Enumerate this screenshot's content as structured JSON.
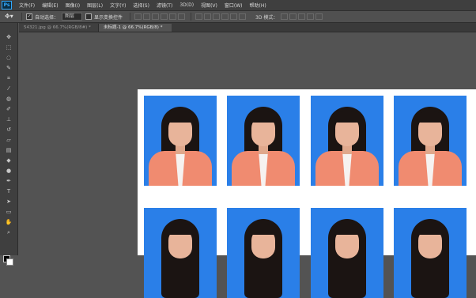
{
  "app": {
    "logo": "Ps"
  },
  "menu": [
    "文件(F)",
    "编辑(E)",
    "图像(I)",
    "图层(L)",
    "文字(Y)",
    "选择(S)",
    "滤镜(T)",
    "3D(D)",
    "视图(V)",
    "窗口(W)",
    "帮助(H)"
  ],
  "options": {
    "move_tool_icon": "move-arrow-icon",
    "auto_select_label": "自动选择：",
    "auto_select_checked": true,
    "auto_select_target": "图层",
    "show_transform_label": "显示变换控件",
    "mode_3d_label": "3D 模式："
  },
  "tabs": [
    {
      "label": "54321.jpg @ 66.7%(RGB/8#) *",
      "active": false
    },
    {
      "label": "未标题-1 @ 66.7%(RGB/8) *",
      "active": true
    }
  ],
  "document": {
    "background": "#535353",
    "photo_bg": "#2a7fe8",
    "paper": "#ffffff"
  }
}
